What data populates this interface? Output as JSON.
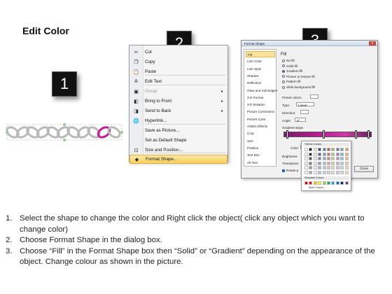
{
  "title": "Edit Color",
  "badges": [
    "1",
    "2",
    "3"
  ],
  "context_menu": {
    "items": [
      {
        "label": "Cut",
        "icon": "scissors-icon",
        "glyph": "✂",
        "arrow": false,
        "disabled": false
      },
      {
        "label": "Copy",
        "icon": "copy-icon",
        "glyph": "❐",
        "arrow": false,
        "disabled": false
      },
      {
        "label": "Paste",
        "icon": "paste-icon",
        "glyph": "📋",
        "arrow": false,
        "disabled": false
      },
      {
        "label": "Edit Text",
        "icon": "edit-text-icon",
        "glyph": "A",
        "arrow": false,
        "disabled": false
      },
      {
        "label": "Group",
        "icon": "group-icon",
        "glyph": "▣",
        "arrow": true,
        "disabled": true
      },
      {
        "label": "Bring to Front",
        "icon": "bring-to-front-icon",
        "glyph": "◧",
        "arrow": true,
        "disabled": false
      },
      {
        "label": "Send to Back",
        "icon": "send-to-back-icon",
        "glyph": "◨",
        "arrow": true,
        "disabled": false
      },
      {
        "label": "Hyperlink...",
        "icon": "hyperlink-icon",
        "glyph": "🌐",
        "arrow": false,
        "disabled": false
      },
      {
        "label": "Save as Picture...",
        "icon": "",
        "glyph": "",
        "arrow": false,
        "disabled": false
      },
      {
        "label": "Set as Default Shape",
        "icon": "",
        "glyph": "",
        "arrow": false,
        "disabled": false
      },
      {
        "label": "Size and Position...",
        "icon": "size-position-icon",
        "glyph": "⊡",
        "arrow": false,
        "disabled": false
      },
      {
        "label": "Format Shape...",
        "icon": "format-shape-icon",
        "glyph": "◆",
        "arrow": false,
        "disabled": false
      }
    ]
  },
  "dialog": {
    "title": "Format Shape",
    "close_glyph": "x",
    "categories": [
      "Fill",
      "Line Color",
      "Line Style",
      "Shadow",
      "Reflection",
      "Glow and Soft Edges",
      "3-D Format",
      "3-D Rotation",
      "Picture Corrections",
      "Picture Color",
      "Artistic Effects",
      "Crop",
      "Size",
      "Position",
      "Text Box",
      "Alt Text"
    ],
    "fill_heading": "Fill",
    "fill_options": [
      "No fill",
      "Solid fill",
      "Gradient fill",
      "Picture or texture fill",
      "Pattern fill",
      "Slide background fill"
    ],
    "preset_colors": "Preset colors:",
    "type_label": "Type:",
    "type_value": "Linear",
    "direction_label": "Direction:",
    "angle_label": "Angle:",
    "angle_value": "0°",
    "gradient_stops": "Gradient stops",
    "color_label": "Color",
    "position_label": "Position:",
    "position_value": "100%",
    "brightness_label": "Brightness",
    "transparency_label": "Transparen",
    "rotate_label": "Rotate p",
    "theme_colors": "Theme Colors",
    "standard_colors": "Standard Colors",
    "more_colors": "More Colors...",
    "close_button": "Close"
  },
  "steps": [
    {
      "n": "1.",
      "text": "Select the shape to change the color and Right click the object( click any object which you want to change color)"
    },
    {
      "n": "2.",
      "text": "Choose Format Shape in the dialog box."
    },
    {
      "n": "3.",
      "text": "Choose “Fill” in the Format Shape box then “Solid” or “Gradient” depending on the appearance of the object. Change colour as shown in the picture."
    }
  ],
  "colors": {
    "highlight": "#f8cf5c",
    "chain_link": "#b9b9b9",
    "selected_link": "#c21c97",
    "badge_bg": "#111111"
  }
}
